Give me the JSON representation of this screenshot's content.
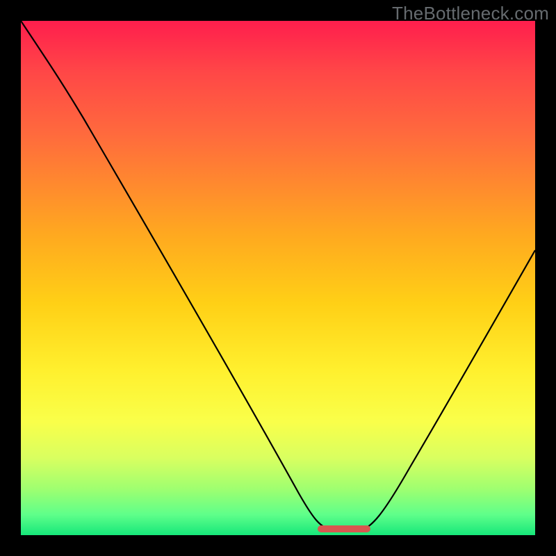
{
  "watermark": "TheBottleneck.com",
  "colors": {
    "frame": "#000000",
    "gradient_top": "#ff1e4d",
    "gradient_bottom": "#16e77a",
    "curve": "#000000",
    "valley_cap": "#d8574f"
  },
  "chart_data": {
    "type": "line",
    "title": "",
    "xlabel": "",
    "ylabel": "",
    "xlim": [
      0,
      100
    ],
    "ylim": [
      0,
      100
    ],
    "x": [
      0,
      5,
      10,
      15,
      20,
      25,
      30,
      35,
      40,
      45,
      50,
      55,
      58,
      62,
      65,
      67,
      70,
      75,
      80,
      85,
      90,
      95,
      100
    ],
    "values": [
      100,
      93,
      85,
      77,
      69,
      61,
      53,
      45,
      36,
      27,
      18,
      8,
      2,
      0,
      0,
      2,
      7,
      16,
      26,
      36,
      46,
      55,
      64
    ],
    "annotations": [
      {
        "type": "valley_floor",
        "x_range": [
          58,
          67
        ],
        "y": 0
      }
    ]
  }
}
